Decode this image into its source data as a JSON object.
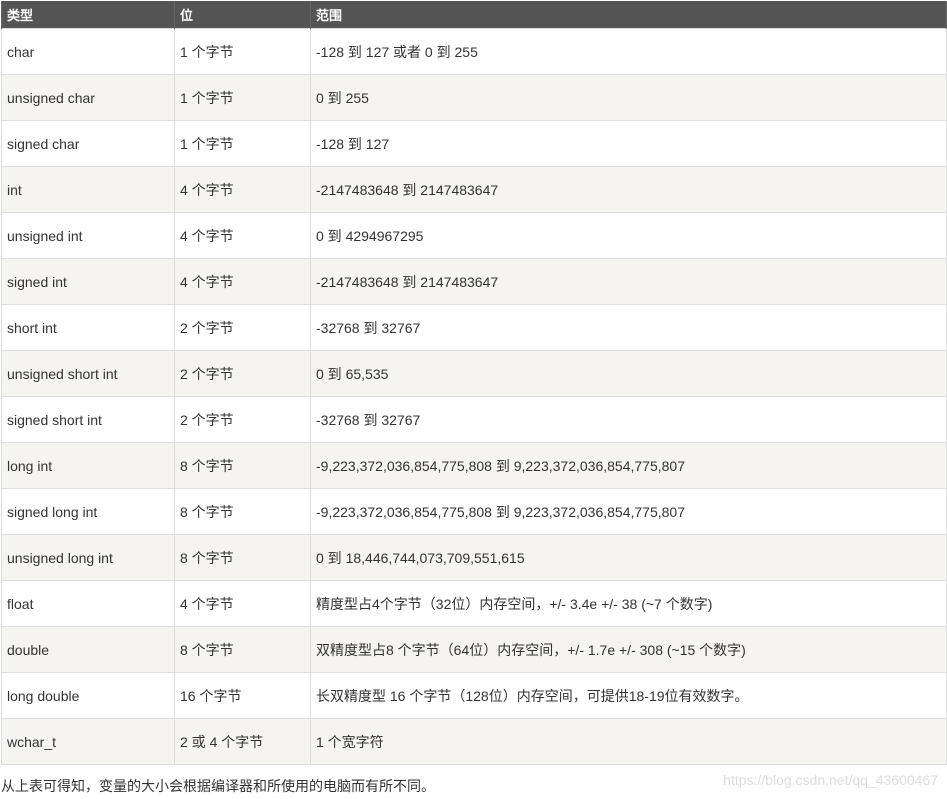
{
  "table": {
    "headers": [
      "类型",
      "位",
      "范围"
    ],
    "rows": [
      [
        "char",
        "1 个字节",
        "-128 到 127 或者 0 到 255"
      ],
      [
        "unsigned char",
        "1 个字节",
        "0 到 255"
      ],
      [
        "signed char",
        "1 个字节",
        "-128 到 127"
      ],
      [
        "int",
        "4 个字节",
        "-2147483648 到 2147483647"
      ],
      [
        "unsigned int",
        "4 个字节",
        "0 到 4294967295"
      ],
      [
        "signed int",
        "4 个字节",
        "-2147483648 到 2147483647"
      ],
      [
        "short int",
        "2 个字节",
        "-32768 到 32767"
      ],
      [
        "unsigned short int",
        "2 个字节",
        "0 到 65,535"
      ],
      [
        "signed short int",
        "2 个字节",
        "-32768 到 32767"
      ],
      [
        "long int",
        "8 个字节",
        "-9,223,372,036,854,775,808 到 9,223,372,036,854,775,807"
      ],
      [
        "signed long int",
        "8 个字节",
        "-9,223,372,036,854,775,808 到 9,223,372,036,854,775,807"
      ],
      [
        "unsigned long int",
        "8 个字节",
        "0 到 18,446,744,073,709,551,615"
      ],
      [
        "float",
        "4 个字节",
        "精度型占4个字节（32位）内存空间，+/- 3.4e +/- 38 (~7 个数字)"
      ],
      [
        "double",
        "8 个字节",
        "双精度型占8 个字节（64位）内存空间，+/- 1.7e +/- 308 (~15 个数字)"
      ],
      [
        "long double",
        "16 个字节",
        "长双精度型 16 个字节（128位）内存空间，可提供18-19位有效数字。"
      ],
      [
        "wchar_t",
        "2 或 4 个字节",
        "1 个宽字符"
      ]
    ]
  },
  "note": "从上表可得知，变量的大小会根据编译器和所使用的电脑而有所不同。",
  "watermark": "https://blog.csdn.net/qq_43600467",
  "colors": {
    "header_bg": "#555555",
    "header_text": "#ffffff",
    "row_alt_bg": "#f6f4f0",
    "border": "#dddddd"
  }
}
